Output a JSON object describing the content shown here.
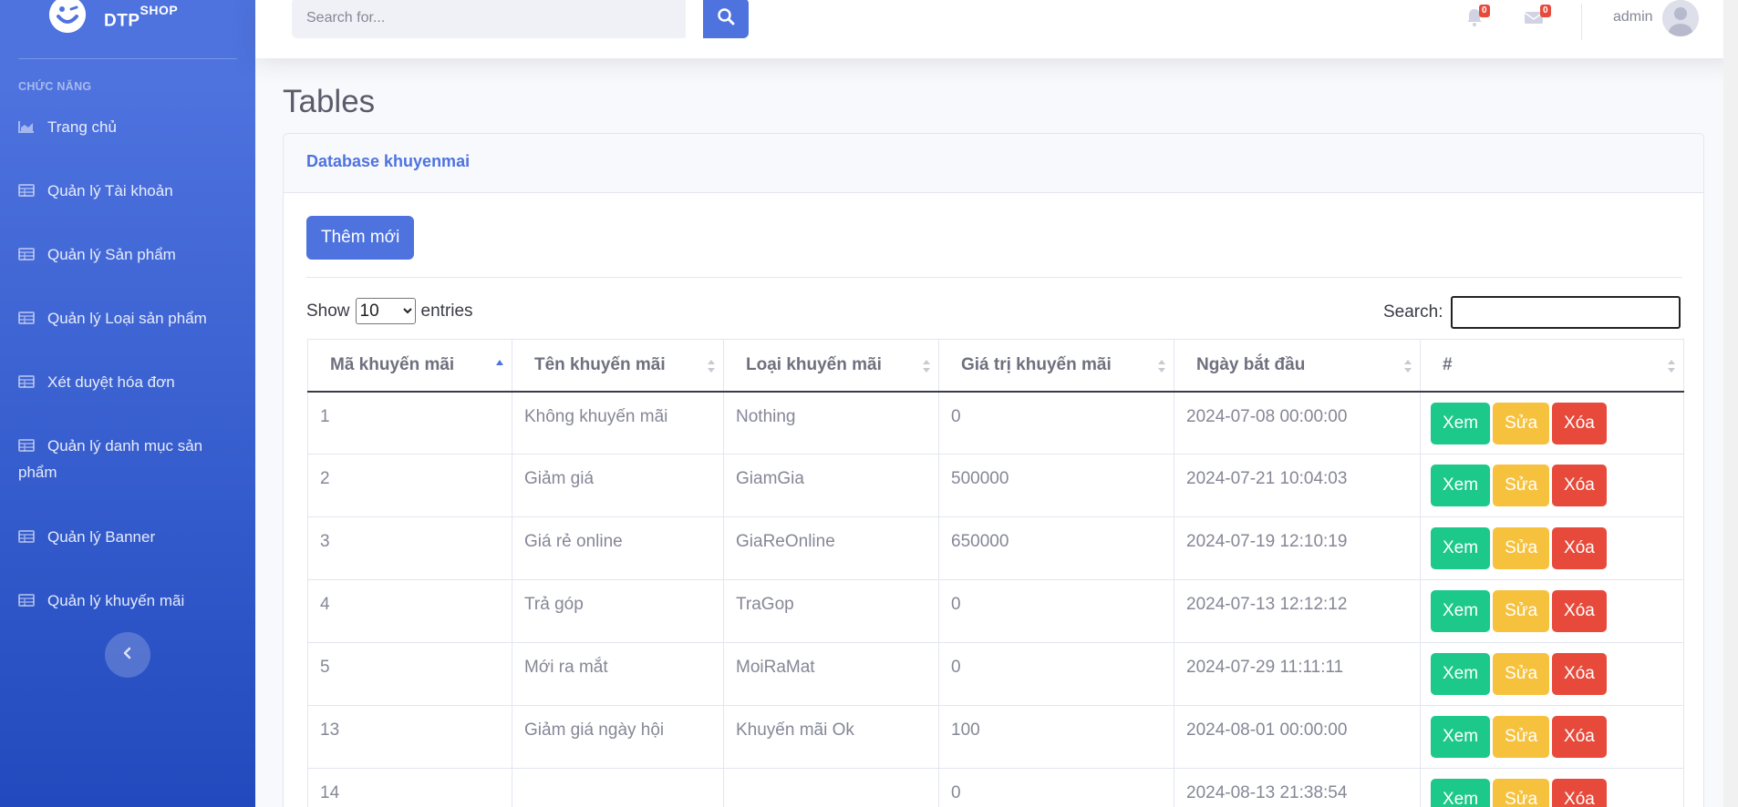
{
  "brand": {
    "name": "DTP",
    "sup": "SHOP"
  },
  "sidebar": {
    "heading": "CHỨC NĂNG",
    "items": [
      {
        "label": "Trang chủ",
        "icon": "chart-area-icon"
      },
      {
        "label": "Quản lý Tài khoản",
        "icon": "table-icon"
      },
      {
        "label": "Quản lý Sản phẩm",
        "icon": "table-icon"
      },
      {
        "label": "Quản lý Loại sản phẩm",
        "icon": "table-icon"
      },
      {
        "label": "Xét duyệt hóa đơn",
        "icon": "table-icon"
      },
      {
        "label": "Quản lý danh mục sản",
        "label2": "phẩm",
        "icon": "table-icon"
      },
      {
        "label": "Quản lý Banner",
        "icon": "table-icon"
      },
      {
        "label": "Quản lý khuyến mãi",
        "icon": "table-icon"
      }
    ]
  },
  "topbar": {
    "search_placeholder": "Search for...",
    "alerts_count": "0",
    "messages_count": "0",
    "user_name": "admin"
  },
  "page": {
    "title": "Tables",
    "card_title": "Database khuyenmai",
    "add_button": "Thêm mới",
    "show_label": "Show",
    "entries_value": "10",
    "entries_label": "entries",
    "search_label": "Search:"
  },
  "table": {
    "columns": [
      "Mã khuyến mãi",
      "Tên khuyến mãi",
      "Loại khuyến mãi",
      "Giá trị khuyến mãi",
      "Ngày bắt đầu",
      "#"
    ],
    "rows": [
      [
        "1",
        "Không khuyến mãi",
        "Nothing",
        "0",
        "2024-07-08 00:00:00"
      ],
      [
        "2",
        "Giảm giá",
        "GiamGia",
        "500000",
        "2024-07-21 10:04:03"
      ],
      [
        "3",
        "Giá rẻ online",
        "GiaReOnline",
        "650000",
        "2024-07-19 12:10:19"
      ],
      [
        "4",
        "Trả góp",
        "TraGop",
        "0",
        "2024-07-13 12:12:12"
      ],
      [
        "5",
        "Mới ra mắt",
        "MoiRaMat",
        "0",
        "2024-07-29 11:11:11"
      ],
      [
        "13",
        "Giảm giá ngày hội",
        "Khuyến mãi Ok",
        "100",
        "2024-08-01 00:00:00"
      ],
      [
        "14",
        "",
        "",
        "0",
        "2024-08-13 21:38:54"
      ]
    ],
    "action_view": "Xem",
    "action_edit": "Sửa",
    "action_delete": "Xóa"
  },
  "colors": {
    "primary": "#4e73df",
    "success": "#1cc88a",
    "warning": "#f6c23e",
    "danger": "#e74a3b"
  }
}
